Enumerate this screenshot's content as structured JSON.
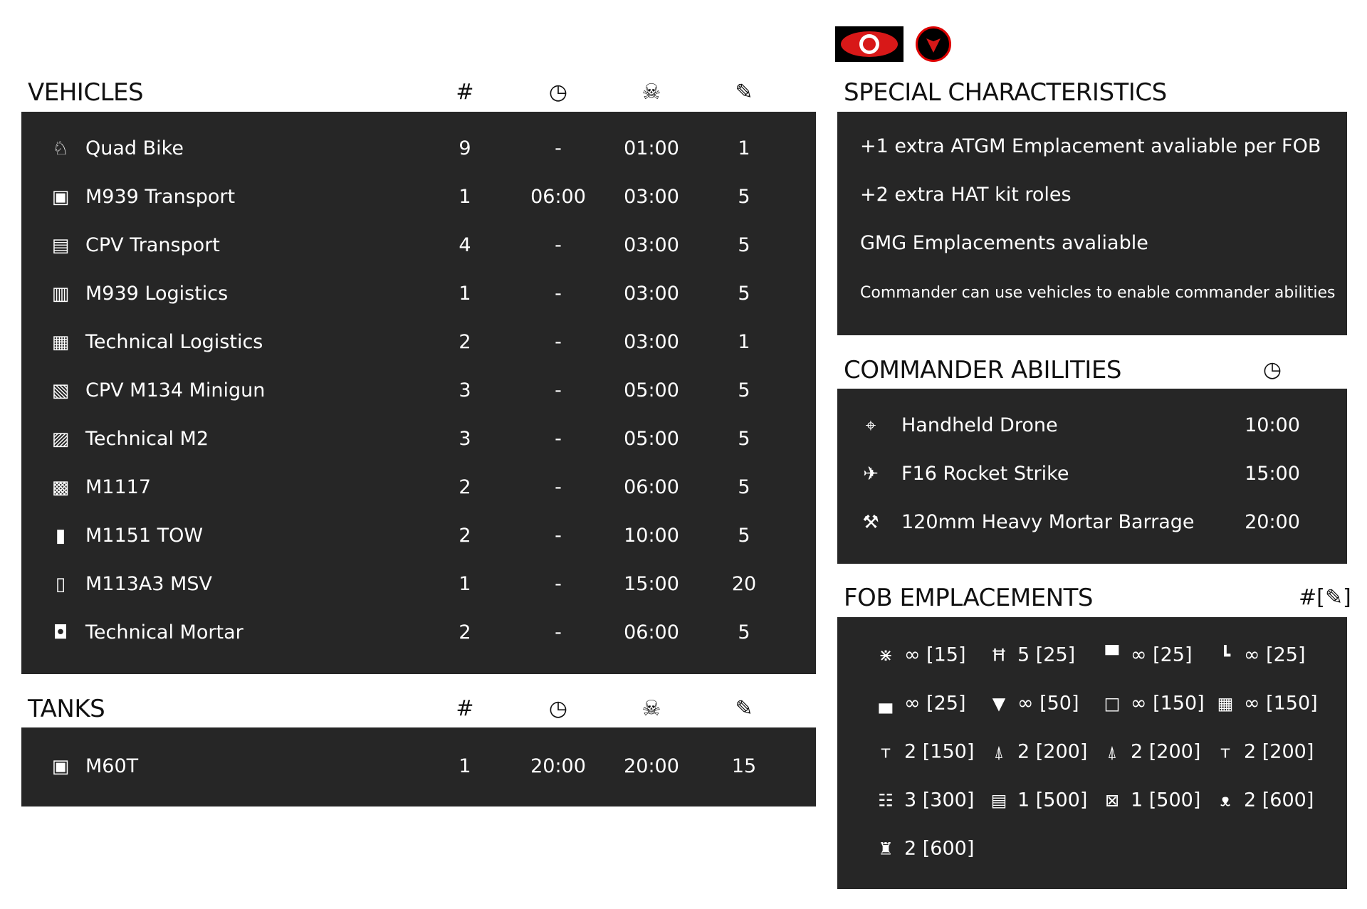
{
  "logos": [
    "eagle-logo",
    "bison-logo"
  ],
  "vehicles": {
    "title": "VEHICLES",
    "columns": {
      "count": "#",
      "delay_icon": "clock-icon",
      "respawn_icon": "skull-icon",
      "ticket_icon": "ticket-icon"
    },
    "rows": [
      {
        "name": "Quad Bike",
        "count": "9",
        "delay": "-",
        "respawn": "01:00",
        "tickets": "1"
      },
      {
        "name": "M939 Transport",
        "count": "1",
        "delay": "06:00",
        "respawn": "03:00",
        "tickets": "5"
      },
      {
        "name": "CPV Transport",
        "count": "4",
        "delay": "-",
        "respawn": "03:00",
        "tickets": "5"
      },
      {
        "name": "M939 Logistics",
        "count": "1",
        "delay": "-",
        "respawn": "03:00",
        "tickets": "5"
      },
      {
        "name": "Technical Logistics",
        "count": "2",
        "delay": "-",
        "respawn": "03:00",
        "tickets": "1"
      },
      {
        "name": "CPV M134 Minigun",
        "count": "3",
        "delay": "-",
        "respawn": "05:00",
        "tickets": "5"
      },
      {
        "name": "Technical M2",
        "count": "3",
        "delay": "-",
        "respawn": "05:00",
        "tickets": "5"
      },
      {
        "name": "M1117",
        "count": "2",
        "delay": "-",
        "respawn": "06:00",
        "tickets": "5"
      },
      {
        "name": "M1151 TOW",
        "count": "2",
        "delay": "-",
        "respawn": "10:00",
        "tickets": "5"
      },
      {
        "name": "M113A3 MSV",
        "count": "1",
        "delay": "-",
        "respawn": "15:00",
        "tickets": "20"
      },
      {
        "name": "Technical Mortar",
        "count": "2",
        "delay": "-",
        "respawn": "06:00",
        "tickets": "5"
      }
    ]
  },
  "tanks": {
    "title": "TANKS",
    "columns": {
      "count": "#"
    },
    "rows": [
      {
        "name": "M60T",
        "count": "1",
        "delay": "20:00",
        "respawn": "20:00",
        "tickets": "15"
      }
    ]
  },
  "special": {
    "title": "SPECIAL CHARACTERISTICS",
    "items": [
      "+1 extra ATGM Emplacement avaliable per FOB",
      "+2 extra HAT kit roles",
      "GMG Emplacements avaliable",
      "Commander can use vehicles to enable commander abilities"
    ]
  },
  "commander": {
    "title": "COMMANDER ABILITIES",
    "items": [
      {
        "name": "Handheld Drone",
        "cooldown": "10:00",
        "icon": "drone-icon"
      },
      {
        "name": "F16 Rocket Strike",
        "cooldown": "15:00",
        "icon": "jet-icon"
      },
      {
        "name": "120mm Heavy Mortar Barrage",
        "cooldown": "20:00",
        "icon": "mortar-icon"
      }
    ]
  },
  "fob": {
    "title": "FOB EMPLACEMENTS",
    "header_label": "#[",
    "header_label_end": "]",
    "items": [
      {
        "icon": "razorwire-icon",
        "text": "∞ [15]"
      },
      {
        "icon": "ladder-icon",
        "text": "5 [25]"
      },
      {
        "icon": "sandbag-icon",
        "text": "∞ [25]"
      },
      {
        "icon": "sandbag-wall-icon",
        "text": "∞ [25]"
      },
      {
        "icon": "sandbag-stack-icon",
        "text": "∞ [25]"
      },
      {
        "icon": "hesco-icon",
        "text": "∞ [50]"
      },
      {
        "icon": "bunker-icon",
        "text": "∞ [150]"
      },
      {
        "icon": "hesco-wall-icon",
        "text": "∞ [150]"
      },
      {
        "icon": "hmg-icon",
        "text": "2 [150]"
      },
      {
        "icon": "mortar-pit-icon",
        "text": "2 [200]"
      },
      {
        "icon": "atgm-icon",
        "text": "2 [200]"
      },
      {
        "icon": "gmg-icon",
        "text": "2 [200]"
      },
      {
        "icon": "hesco-bunker-icon",
        "text": "3 [300]"
      },
      {
        "icon": "ammo-crate-icon",
        "text": "1 [500]"
      },
      {
        "icon": "repair-station-icon",
        "text": "1 [500]"
      },
      {
        "icon": "tow-icon",
        "text": "2 [600]"
      },
      {
        "icon": "watchtower-icon",
        "text": "2 [600]"
      }
    ]
  }
}
